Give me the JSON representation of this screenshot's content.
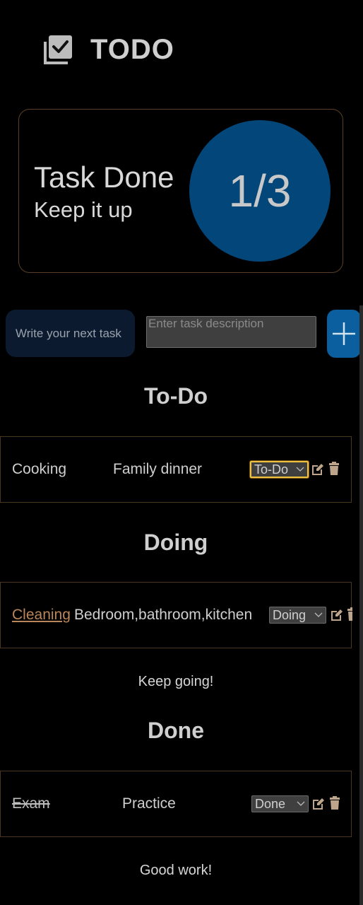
{
  "header": {
    "title": "TODO",
    "icon": "checkbox-icon"
  },
  "stats": {
    "title": "Task Done",
    "subtitle": "Keep it up",
    "count": "1/3",
    "circle_color": "#02467a"
  },
  "new_task": {
    "name_placeholder": "Write your next task",
    "description_placeholder": "Enter task description",
    "add_icon": "plus-icon"
  },
  "sections": {
    "todo": {
      "heading": "To-Do",
      "tasks": [
        {
          "name": "Cooking",
          "description": "Family dinner",
          "status": "To-Do"
        }
      ]
    },
    "doing": {
      "heading": "Doing",
      "tasks": [
        {
          "name": "Cleaning",
          "description": "Bedroom,bathroom,kitchen",
          "status": "Doing"
        }
      ],
      "message": "Keep going!"
    },
    "done": {
      "heading": "Done",
      "tasks": [
        {
          "name": "Exam",
          "description": "Practice",
          "status": "Done"
        }
      ],
      "message": "Good work!"
    }
  },
  "colors": {
    "accent": "#0c5f9e",
    "border": "#4a3520",
    "focus": "#f0c040",
    "link": "#b8865a"
  }
}
